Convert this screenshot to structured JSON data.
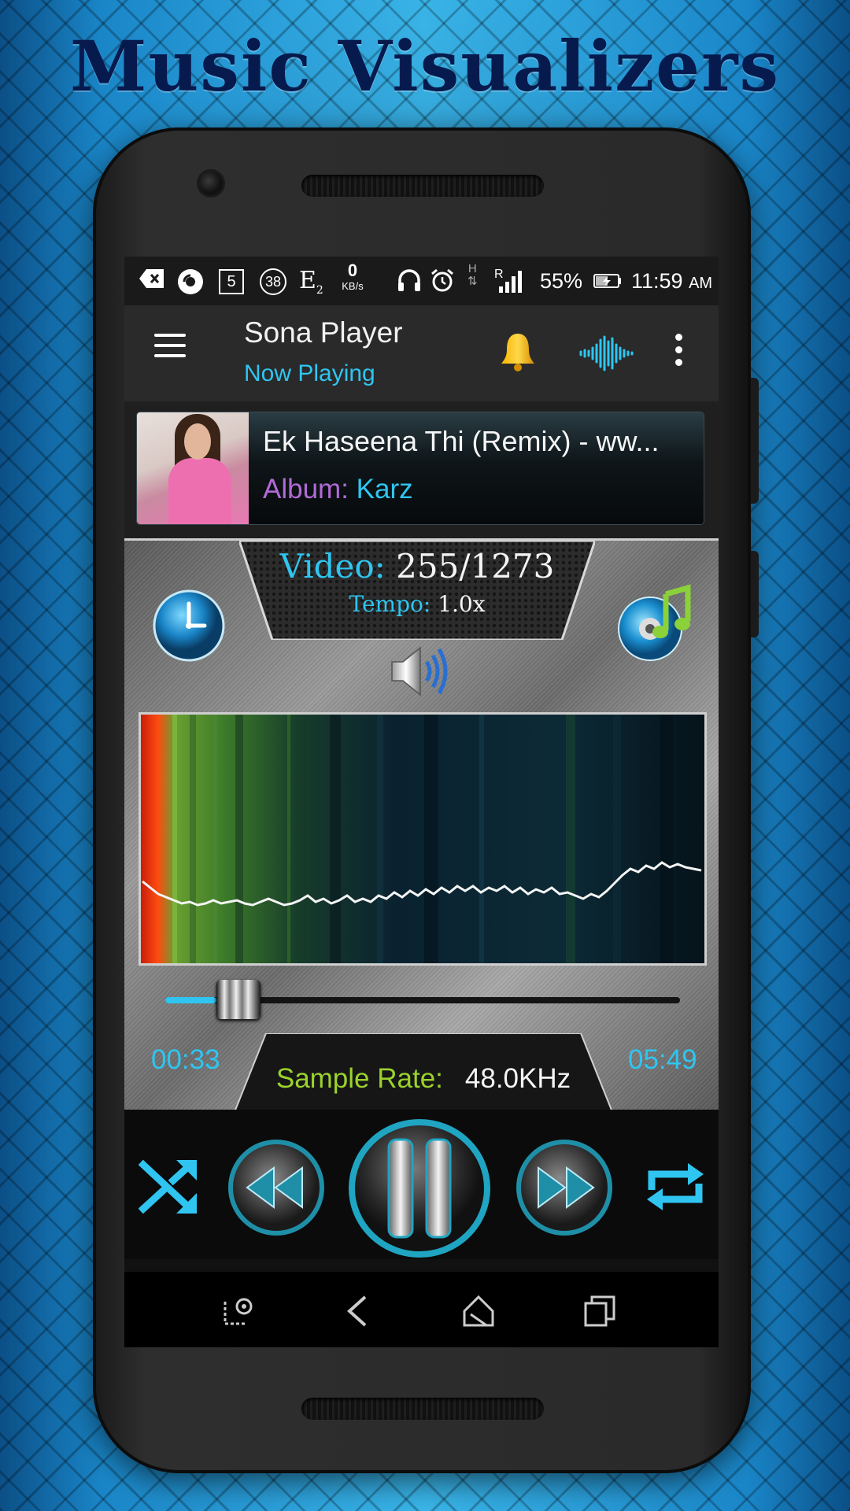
{
  "hero": {
    "title": "Music Visualizers"
  },
  "status_bar": {
    "box_icon_text": "5",
    "circle_icon_text": "38",
    "network_e": "E",
    "network_e_sub": "2",
    "data_speed": "0",
    "data_unit": "KB/s",
    "net_h": "H",
    "net_r": "R",
    "battery": "55%",
    "time": "11:59",
    "ampm": "AM"
  },
  "app_bar": {
    "title": "Sona Player",
    "subtitle": "Now Playing"
  },
  "now_playing": {
    "song_title": "Ek Haseena Thi (Remix) - ww...",
    "album_label": "Album: ",
    "album_name": "Karz"
  },
  "player_info": {
    "video_label": "Video: ",
    "video_value": "255/1273",
    "tempo_label": "Tempo: ",
    "tempo_value": "1.0x"
  },
  "playback": {
    "current_time": "00:33",
    "total_time": "05:49",
    "progress_fraction": 0.1,
    "sample_rate_label": "Sample Rate:",
    "sample_rate_value": "48.0KHz"
  },
  "colors": {
    "accent": "#2fc5f0",
    "sample_rate_label": "#9bd22c",
    "album_label": "#b26ad6"
  },
  "icons": {
    "menu": "hamburger-menu-icon",
    "bell": "bell-icon",
    "visualizer": "sound-wave-icon",
    "more": "more-vert-icon",
    "timer": "clock-icon",
    "library": "music-disc-icon",
    "volume": "speaker-icon",
    "shuffle": "shuffle-icon",
    "rewind": "rewind-icon",
    "pause": "pause-icon",
    "forward": "fast-forward-icon",
    "repeat": "repeat-icon"
  }
}
